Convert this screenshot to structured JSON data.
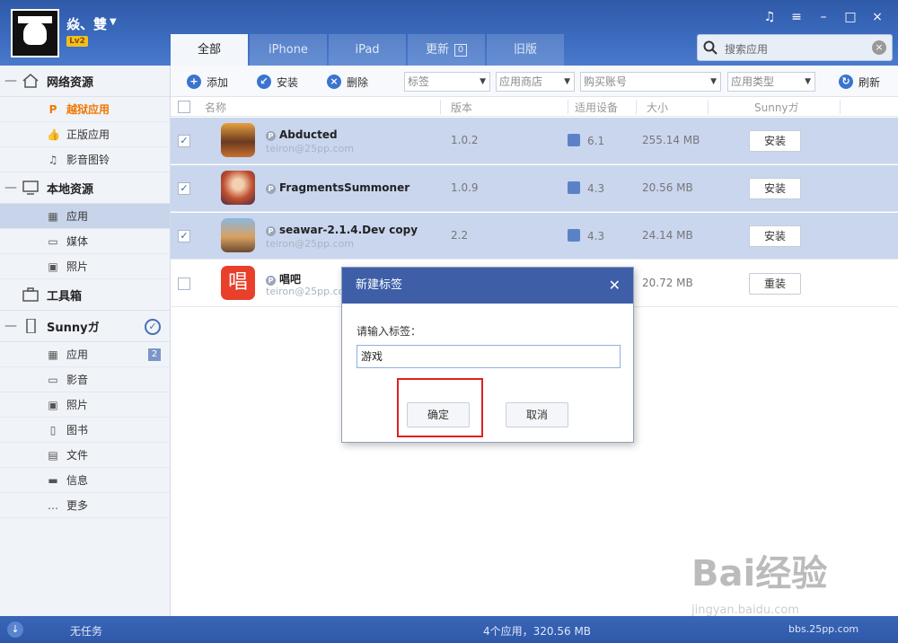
{
  "user": {
    "name": "焱、雙",
    "level": "Lv2"
  },
  "tabs": [
    {
      "label": "全部",
      "active": true
    },
    {
      "label": "iPhone"
    },
    {
      "label": "iPad"
    },
    {
      "label": "更新",
      "count": "0"
    },
    {
      "label": "旧版"
    }
  ],
  "search": {
    "placeholder": "搜索应用"
  },
  "window_controls": [
    "♫",
    "≡",
    "–",
    "□",
    "×"
  ],
  "sidebar": {
    "groups": [
      {
        "label": "网络资源",
        "items": [
          {
            "label": "越狱应用",
            "highlight": true
          },
          {
            "label": "正版应用"
          },
          {
            "label": "影音图铃"
          }
        ]
      },
      {
        "label": "本地资源",
        "items": [
          {
            "label": "应用",
            "selected": true
          },
          {
            "label": "媒体"
          },
          {
            "label": "照片"
          }
        ]
      },
      {
        "label": "工具箱"
      },
      {
        "label": "Sunnyガ",
        "items": [
          {
            "label": "应用",
            "count": "2"
          },
          {
            "label": "影音"
          },
          {
            "label": "照片"
          },
          {
            "label": "图书"
          },
          {
            "label": "文件"
          },
          {
            "label": "信息"
          },
          {
            "label": "更多"
          }
        ]
      }
    ]
  },
  "toolbar": {
    "add": "添加",
    "install": "安装",
    "delete": "删除",
    "filters": [
      "标签",
      "应用商店",
      "购买账号",
      "应用类型"
    ],
    "refresh": "刷新"
  },
  "table": {
    "headers": [
      "名称",
      "版本",
      "适用设备",
      "大小",
      "Sunnyガ"
    ],
    "rows": [
      {
        "name": "Abducted",
        "account": "teiron@25pp.com",
        "version": "1.0.2",
        "device": "6.1",
        "size": "255.14 MB",
        "action": "安装",
        "checked": true
      },
      {
        "name": "FragmentsSummoner",
        "account": "",
        "version": "1.0.9",
        "device": "4.3",
        "size": "20.56 MB",
        "action": "安装",
        "checked": true
      },
      {
        "name": "seawar-2.1.4.Dev copy",
        "account": "teiron@25pp.com",
        "version": "2.2",
        "device": "4.3",
        "size": "24.14 MB",
        "action": "安装",
        "checked": true
      },
      {
        "name": "唱吧",
        "account": "teiron@25pp.co",
        "version": "",
        "device": "",
        "size": "20.72 MB",
        "action": "重装",
        "checked": false
      }
    ]
  },
  "dialog": {
    "title": "新建标签",
    "label": "请输入标签：",
    "value": "游戏",
    "confirm": "确定",
    "cancel": "取消"
  },
  "status": {
    "task": "无任务",
    "summary": "4个应用，320.56 MB",
    "site": "bbs.25pp.com"
  },
  "watermark": {
    "brand": "Bai经验",
    "url": "jingyan.baidu.com"
  }
}
